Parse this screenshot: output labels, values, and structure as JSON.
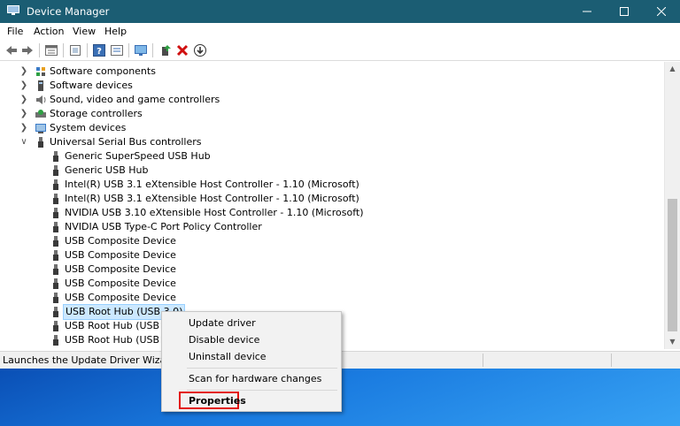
{
  "window": {
    "title": "Device Manager"
  },
  "menu": [
    "File",
    "Action",
    "View",
    "Help"
  ],
  "toolbar_icons": [
    "back-arrow-icon",
    "forward-arrow-icon",
    "properties-pane-icon",
    "grid-icon",
    "help-icon",
    "devices-view-icon",
    "monitor-scan-icon",
    "update-driver-icon",
    "uninstall-x-icon",
    "download-circle-icon"
  ],
  "tree": {
    "categories": [
      {
        "label": "Software components",
        "icon": "puzzle-icon"
      },
      {
        "label": "Software devices",
        "icon": "chip-icon"
      },
      {
        "label": "Sound, video and game controllers",
        "icon": "speaker-icon"
      },
      {
        "label": "Storage controllers",
        "icon": "storage-icon"
      },
      {
        "label": "System devices",
        "icon": "system-icon"
      },
      {
        "label": "Universal Serial Bus controllers",
        "icon": "usb-icon",
        "expanded": true
      }
    ],
    "usb_children": [
      "Generic SuperSpeed USB Hub",
      "Generic USB Hub",
      "Intel(R) USB 3.1 eXtensible Host Controller - 1.10 (Microsoft)",
      "Intel(R) USB 3.1 eXtensible Host Controller - 1.10 (Microsoft)",
      "NVIDIA USB 3.10 eXtensible Host Controller - 1.10 (Microsoft)",
      "NVIDIA USB Type-C Port Policy Controller",
      "USB Composite Device",
      "USB Composite Device",
      "USB Composite Device",
      "USB Composite Device",
      "USB Composite Device",
      "USB Root Hub (USB 3.0)",
      "USB Root Hub (USB 3.0)",
      "USB Root Hub (USB 3.0)"
    ],
    "selected_child_index": 11
  },
  "status": {
    "text": "Launches the Update Driver Wizard for t"
  },
  "context_menu": {
    "items": [
      "Update driver",
      "Disable device",
      "Uninstall device",
      "Scan for hardware changes",
      "Properties"
    ],
    "highlighted": "Properties",
    "highlight_color": "#e3140f"
  },
  "colors": {
    "titlebar": "#1b5d73",
    "selection": "#cce8ff"
  }
}
